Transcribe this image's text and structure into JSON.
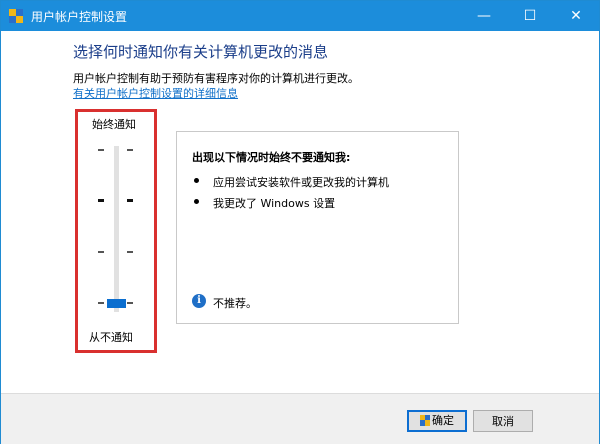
{
  "window": {
    "title": "用户帐户控制设置",
    "minimize_glyph": "—",
    "maximize_glyph": "☐",
    "close_glyph": "✕"
  },
  "main": {
    "heading": "选择何时通知你有关计算机更改的消息",
    "description": "用户帐户控制有助于预防有害程序对你的计算机进行更改。",
    "link_text": "有关用户帐户控制设置的详细信息"
  },
  "slider": {
    "top_label": "始终通知",
    "bottom_label": "从不通知",
    "levels": 4,
    "selected_level": 1,
    "highlight_color": "#d9302f",
    "thumb_color": "#0b6ecf"
  },
  "info": {
    "title": "出现以下情况时始终不要通知我:",
    "bullets": [
      "应用尝试安装软件或更改我的计算机",
      "我更改了 Windows 设置"
    ],
    "note": "不推荐。",
    "note_icon": "info-icon",
    "note_icon_glyph": "i"
  },
  "buttons": {
    "ok": "确定",
    "cancel": "取消"
  },
  "colors": {
    "titlebar": "#1c8ddb",
    "heading": "#1b3e8a",
    "link": "#1170c9"
  }
}
